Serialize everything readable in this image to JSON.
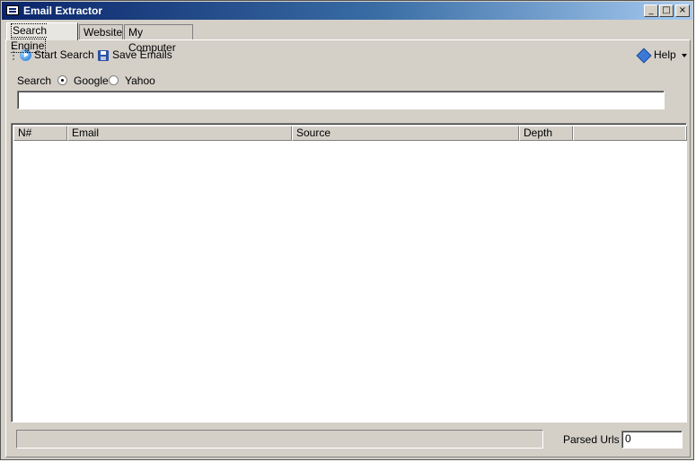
{
  "window": {
    "title": "Email Extractor",
    "icon": "window-app-icon"
  },
  "controls": {
    "minimize": "_",
    "maximize": "□",
    "close": "×"
  },
  "tabs": [
    {
      "label": "Search Engine",
      "active": true
    },
    {
      "label": "Website",
      "active": false
    },
    {
      "label": "My Computer",
      "active": false
    }
  ],
  "toolbar": {
    "start_search": "Start Search",
    "save_emails": "Save Emails",
    "help": "Help"
  },
  "search": {
    "label": "Search",
    "options": [
      {
        "label": "Google",
        "checked": true
      },
      {
        "label": "Yahoo",
        "checked": false
      }
    ],
    "query": ""
  },
  "table": {
    "columns": [
      "N#",
      "Email",
      "Source",
      "Depth"
    ],
    "rows": []
  },
  "status": {
    "parsed_label": "Parsed Urls",
    "parsed_value": "0"
  },
  "colors": {
    "title_gradient_start": "#0a246a",
    "title_gradient_end": "#a6caf0",
    "face": "#d4d0c8"
  }
}
